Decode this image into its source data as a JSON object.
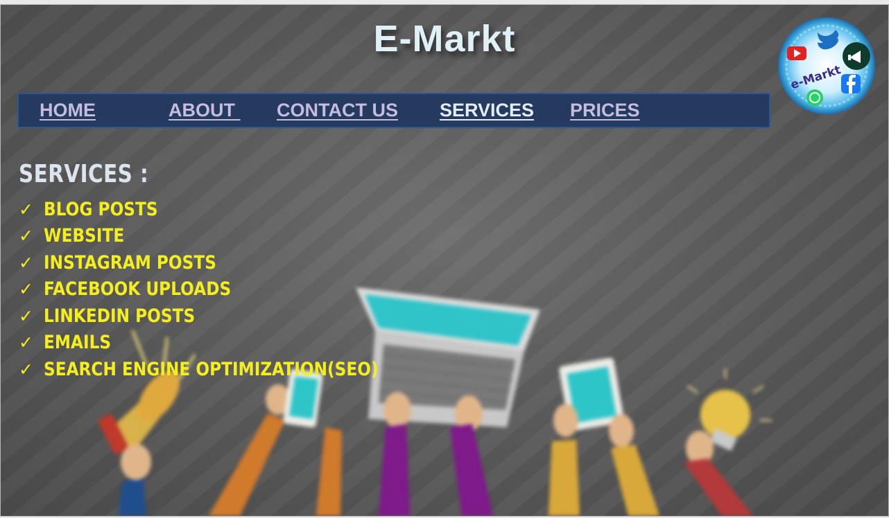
{
  "header": {
    "title": "E-Markt",
    "logo_text": "e-Markt",
    "logo_icons": [
      "youtube-icon",
      "twitter-icon",
      "megaphone-icon",
      "facebook-icon",
      "whatsapp-icon"
    ]
  },
  "nav": {
    "items": [
      {
        "label": "HOME"
      },
      {
        "label": "ABOUT "
      },
      {
        "label": "CONTACT US"
      },
      {
        "label": "SERVICES"
      },
      {
        "label": "PRICES"
      }
    ]
  },
  "main": {
    "heading": "SERVICES :",
    "check_symbol": "✓",
    "services": [
      "BLOG POSTS",
      "WEBSITE",
      "INSTAGRAM POSTS",
      "FACEBOOK UPLOADS",
      "LINKEDIN POSTS",
      "EMAILS",
      "SEARCH ENGINE OPTIMIZATION(SEO)"
    ]
  },
  "colors": {
    "navbar_bg": "#243b5f",
    "nav_link": "#c6bce0",
    "service_text": "#f5ee1f",
    "title": "#dff1f7"
  }
}
